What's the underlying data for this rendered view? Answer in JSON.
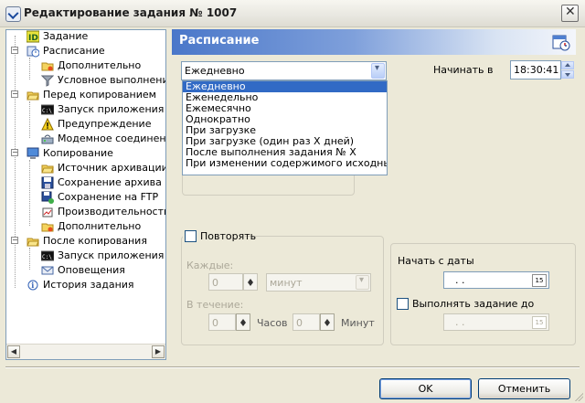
{
  "window": {
    "title": "Редактирование задания № 1007",
    "close_label": "✕"
  },
  "tree": {
    "items": [
      {
        "label": "Задание",
        "icon": "id-icon",
        "level": 0
      },
      {
        "label": "Расписание",
        "icon": "schedule-icon",
        "level": 0
      },
      {
        "label": "Дополнительно",
        "icon": "folder-gear-icon",
        "level": 1
      },
      {
        "label": "Условное выполнение",
        "icon": "filter-icon",
        "level": 1
      },
      {
        "label": "Перед копированием",
        "icon": "folder-open-icon",
        "level": 0
      },
      {
        "label": "Запуск приложения",
        "icon": "console-icon",
        "level": 1
      },
      {
        "label": "Предупреждение",
        "icon": "warning-icon",
        "level": 1
      },
      {
        "label": "Модемное соединение",
        "icon": "modem-icon",
        "level": 1
      },
      {
        "label": "Копирование",
        "icon": "computer-icon",
        "level": 0
      },
      {
        "label": "Источник архивации",
        "icon": "folder-open-icon",
        "level": 1
      },
      {
        "label": "Сохранение архива",
        "icon": "floppy-icon",
        "level": 1
      },
      {
        "label": "Сохранение на FTP",
        "icon": "floppy-network-icon",
        "level": 1
      },
      {
        "label": "Производительность",
        "icon": "performance-icon",
        "level": 1
      },
      {
        "label": "Дополнительно",
        "icon": "folder-gear-icon",
        "level": 1
      },
      {
        "label": "После копирования",
        "icon": "folder-open-icon",
        "level": 0
      },
      {
        "label": "Запуск приложения",
        "icon": "console-icon",
        "level": 1
      },
      {
        "label": "Оповещения",
        "icon": "envelope-icon",
        "level": 1
      },
      {
        "label": "История задания",
        "icon": "history-icon",
        "level": 0
      }
    ],
    "expanders": [
      "−",
      "−",
      "−",
      "−"
    ]
  },
  "header": {
    "title": "Расписание",
    "icon": "calendar-clock-icon"
  },
  "schedule": {
    "frequency_value": "Ежедневно",
    "frequency_options": [
      "Ежедневно",
      "Еженедельно",
      "Ежемесячно",
      "Однократно",
      "При загрузке",
      "При загрузке (один раз X дней)",
      "После выполнения задания № X",
      "При изменении содержимого исходных папок"
    ],
    "start_at_label": "Начинать в",
    "start_at_value": "18:30:41"
  },
  "repeat": {
    "checkbox_label": "Повторять",
    "every_label": "Каждые:",
    "every_value": "0",
    "every_unit": "минут",
    "during_label": "В течение:",
    "hours_value": "0",
    "hours_label": "Часов",
    "minutes_value": "0",
    "minutes_label": "Минут"
  },
  "dates": {
    "start_date_label": "Начать с даты",
    "start_date_value": ". .",
    "until_label": "Выполнять задание до",
    "until_value": ". ."
  },
  "buttons": {
    "ok": "OK",
    "cancel": "Отменить"
  },
  "scroll": {
    "left": "◀",
    "right": "▶"
  },
  "colors": {
    "header_start": "#4A77C9",
    "selection": "#316AC5",
    "border": "#7F9DB9"
  }
}
